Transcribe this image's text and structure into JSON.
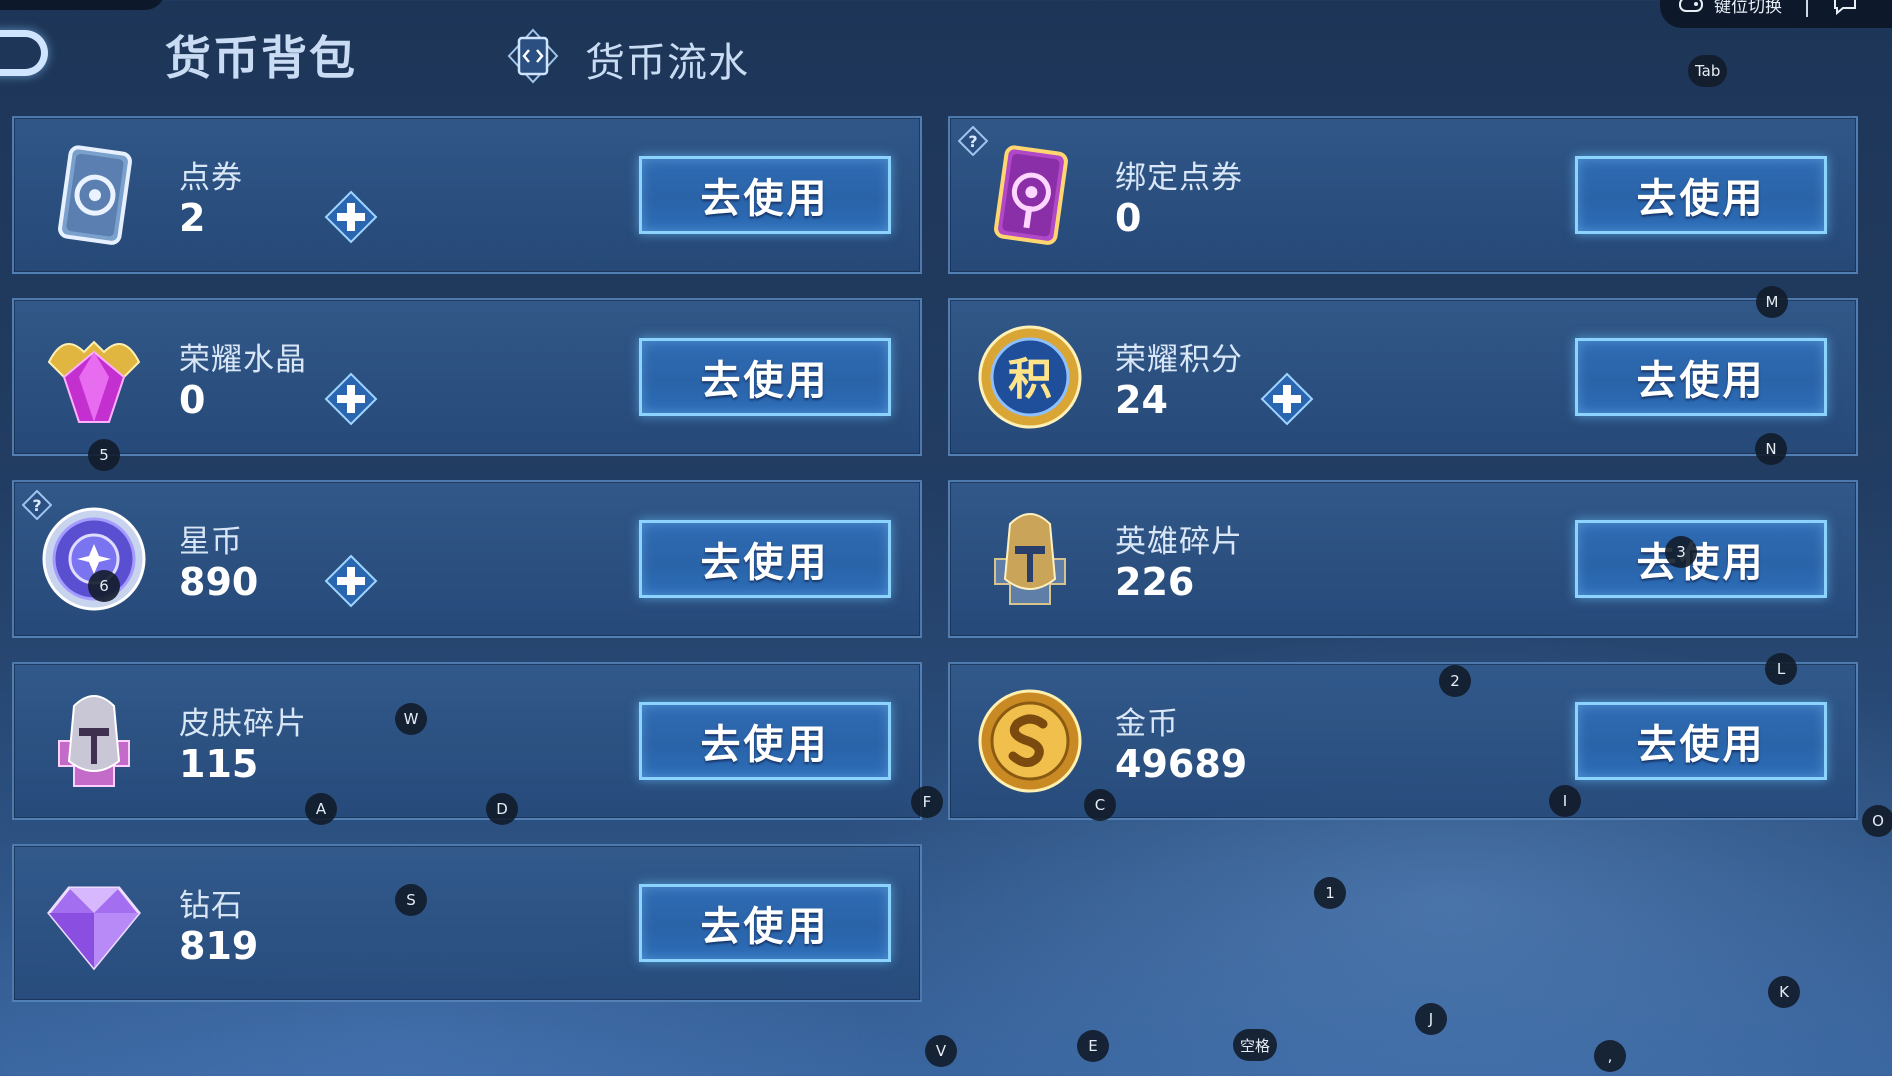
{
  "header": {
    "active_tab": "货币背包",
    "flow_tab": "货币流水",
    "top_right_label": "键位切换"
  },
  "use_button_label": "去使用",
  "currencies": [
    {
      "name": "点券",
      "amount": "2",
      "icon": "voucher-card-icon",
      "has_plus": true,
      "has_help": false
    },
    {
      "name": "绑定点券",
      "amount": "0",
      "icon": "bound-voucher-card-icon",
      "has_plus": false,
      "has_help": true
    },
    {
      "name": "荣耀水晶",
      "amount": "0",
      "icon": "glory-crystal-icon",
      "has_plus": true,
      "has_help": false
    },
    {
      "name": "荣耀积分",
      "amount": "24",
      "icon": "glory-points-icon",
      "has_plus": true,
      "has_help": false
    },
    {
      "name": "星币",
      "amount": "890",
      "icon": "star-coin-icon",
      "has_plus": true,
      "has_help": true
    },
    {
      "name": "英雄碎片",
      "amount": "226",
      "icon": "hero-fragment-icon",
      "has_plus": false,
      "has_help": false
    },
    {
      "name": "皮肤碎片",
      "amount": "115",
      "icon": "skin-fragment-icon",
      "has_plus": false,
      "has_help": false
    },
    {
      "name": "金币",
      "amount": "49689",
      "icon": "gold-coin-icon",
      "has_plus": false,
      "has_help": false
    },
    {
      "name": "钻石",
      "amount": "819",
      "icon": "diamond-icon",
      "has_plus": false,
      "has_help": false
    }
  ],
  "glory_points_glyph": "积",
  "key_hints": {
    "tab": "Tab",
    "m": "M",
    "n": "N",
    "five": "5",
    "six": "6",
    "three": "3",
    "two": "2",
    "l": "L",
    "w": "W",
    "a": "A",
    "d": "D",
    "f": "F",
    "c": "C",
    "i": "I",
    "o": "O",
    "one": "1",
    "s": "S",
    "k": "K",
    "j": "J",
    "v": "V",
    "e": "E",
    "space": "空格",
    "comma": ","
  },
  "colors": {
    "button_border": "#8dd3ff",
    "button_fill": "#2f6cb4",
    "card_fill": "#2f5a8e",
    "background": "#223d63"
  }
}
